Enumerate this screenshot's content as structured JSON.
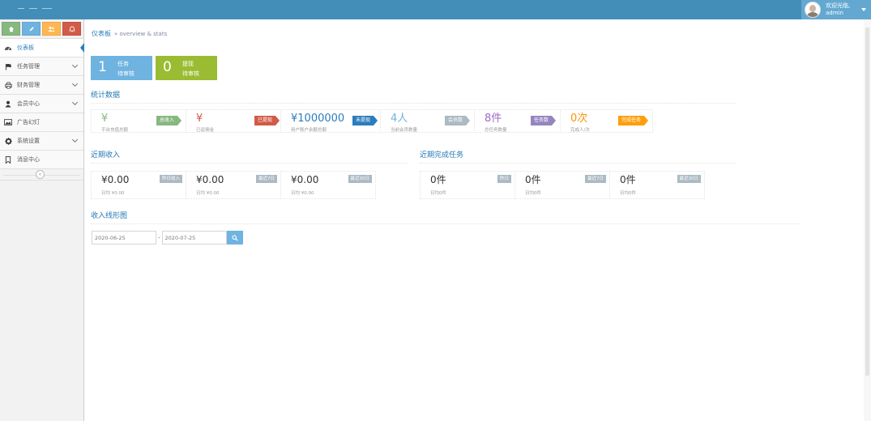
{
  "navbar": {
    "user": {
      "greeting": "欢迎光临,",
      "name": "admin"
    }
  },
  "sidebar": {
    "shortcuts": [
      {
        "icon": "home-icon",
        "color": "#87b87f"
      },
      {
        "icon": "pencil-icon",
        "color": "#6fb3e0"
      },
      {
        "icon": "users-icon",
        "color": "#ffb752"
      },
      {
        "icon": "bell-icon",
        "color": "#d15b47"
      }
    ],
    "items": [
      {
        "label": "仪表板",
        "icon": "dashboard-icon",
        "active": true,
        "submenu": false
      },
      {
        "label": "任务管理",
        "icon": "flag-icon",
        "active": false,
        "submenu": true
      },
      {
        "label": "财务管理",
        "icon": "print-icon",
        "active": false,
        "submenu": true
      },
      {
        "label": "会员中心",
        "icon": "user-icon",
        "active": false,
        "submenu": true
      },
      {
        "label": "广告幻灯",
        "icon": "image-icon",
        "active": false,
        "submenu": false
      },
      {
        "label": "系统设置",
        "icon": "gear-icon",
        "active": false,
        "submenu": true
      },
      {
        "label": "消息中心",
        "icon": "bookmark-icon",
        "active": false,
        "submenu": false
      }
    ],
    "collapse_symbol": "«"
  },
  "breadcrumb": {
    "title": "仪表板",
    "sub": "» overview & stats"
  },
  "infoboxes": [
    {
      "value": "1",
      "line1": "任务",
      "line2": "待审核",
      "color": "#6fb3e0"
    },
    {
      "value": "0",
      "line1": "提现",
      "line2": "待审核",
      "color": "#9abc32"
    }
  ],
  "stats": {
    "title": "统计数据",
    "items": [
      {
        "value": "¥",
        "label": "平台充值总额",
        "tag": "总收入",
        "value_color": "#87b87f",
        "tag_color": "#87b87f"
      },
      {
        "value": "¥",
        "label": "已返佣金",
        "tag": "已提现",
        "value_color": "#d15b47",
        "tag_color": "#d15b47"
      },
      {
        "value": "¥1000000",
        "label": "用户账户余额总额",
        "tag": "未提现",
        "value_color": "#2b7dbc",
        "tag_color": "#2b7dbc"
      },
      {
        "value": "4人",
        "label": "当前会员数量",
        "tag": "会员数",
        "value_color": "#6fb3e0",
        "tag_color": "#abbac3"
      },
      {
        "value": "8件",
        "label": "总任务数量",
        "tag": "任务数",
        "value_color": "#a069c3",
        "tag_color": "#9585bf"
      },
      {
        "value": "0次",
        "label": "完成人/次",
        "tag": "完成任务",
        "value_color": "#f89406",
        "tag_color": "#ff9e0c"
      }
    ]
  },
  "recent_income": {
    "title": "近期收入",
    "items": [
      {
        "value": "¥0.00",
        "label": "日均 ¥0.00",
        "badge": "昨日收入"
      },
      {
        "value": "¥0.00",
        "label": "日均 ¥0.00",
        "badge": "最近7日"
      },
      {
        "value": "¥0.00",
        "label": "日均 ¥0.00",
        "badge": "最近30日"
      }
    ]
  },
  "recent_tasks": {
    "title": "近期完成任务",
    "items": [
      {
        "value": "0件",
        "label": "日均0件",
        "badge": "昨日"
      },
      {
        "value": "0件",
        "label": "日均0件",
        "badge": "最近7日"
      },
      {
        "value": "0件",
        "label": "日均0件",
        "badge": "最近30日"
      }
    ]
  },
  "income_chart": {
    "title": "收入线形图",
    "start_date": "2020-06-25",
    "separator": "-",
    "end_date": "2020-07-25",
    "search_icon": "search-icon"
  }
}
